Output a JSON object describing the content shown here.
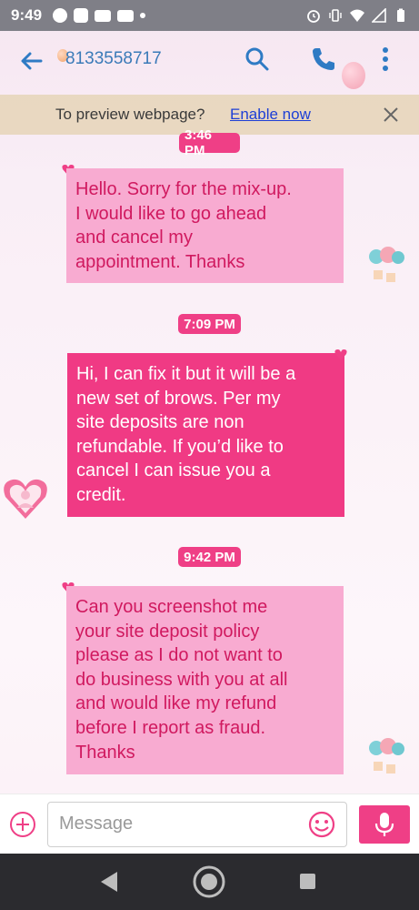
{
  "status_bar": {
    "time": "9:49",
    "left_icons": [
      "pinterest-icon",
      "app-icon",
      "youtube-icon",
      "youtube-icon",
      "dot-icon"
    ],
    "right_icons": [
      "alarm-icon",
      "vibrate-icon",
      "wifi-icon",
      "signal-icon",
      "battery-icon"
    ]
  },
  "header": {
    "contact": "8133558717",
    "back_icon": "back-arrow-icon",
    "actions": [
      "search-icon",
      "phone-icon",
      "more-vert-icon"
    ],
    "accent_color": "#2f7bc4"
  },
  "preview_banner": {
    "text": "To preview webpage?",
    "link": "Enable now",
    "close_icon": "close-icon"
  },
  "messages": [
    {
      "timestamp": "3:46 PM",
      "direction": "sent",
      "text": "Hello. Sorry for the mix-up. I would like to go ahead and cancel my appointment. Thanks",
      "lines": [
        "Hello. Sorry for the mix-up.",
        "I would like to go ahead",
        "and cancel my",
        "appointment. Thanks"
      ]
    },
    {
      "timestamp": "7:09 PM",
      "direction": "received",
      "text": "Hi, I can fix it but it will be a new set of brows. Per my site deposits are non refundable. If you'd like to cancel I can issue you a credit.",
      "lines": [
        "Hi, I can fix it but it will be a",
        "new set of brows. Per my",
        "site deposits are non",
        "refundable. If you’d like to",
        "cancel I can issue you a",
        "credit."
      ]
    },
    {
      "timestamp": "9:42 PM",
      "direction": "sent",
      "text": "Can you screenshot me your site deposit policy please as I do not want to do business with you at all and would like my refund before I report as fraud. Thanks",
      "lines": [
        "Can you screenshot me",
        "your site deposit policy",
        "please as I do not want to",
        "do business with you at all",
        "and would like my refund",
        "before I report as fraud.",
        "Thanks"
      ]
    }
  ],
  "input_bar": {
    "placeholder": "Message",
    "add_icon": "add-circle-icon",
    "emoji_icon": "emoji-icon",
    "mic_icon": "microphone-icon"
  },
  "nav_bar": {
    "icons": [
      "nav-back-icon",
      "nav-home-icon",
      "nav-recents-icon"
    ]
  },
  "colors": {
    "timestamp_bg": "#ef3f86",
    "sent_bubble": "#f8abd1",
    "sent_text": "#d0195f",
    "received_bubble": "#f03a84",
    "received_text": "#ffffff",
    "banner_bg": "#e6d5b9",
    "link": "#1d3fd6"
  }
}
